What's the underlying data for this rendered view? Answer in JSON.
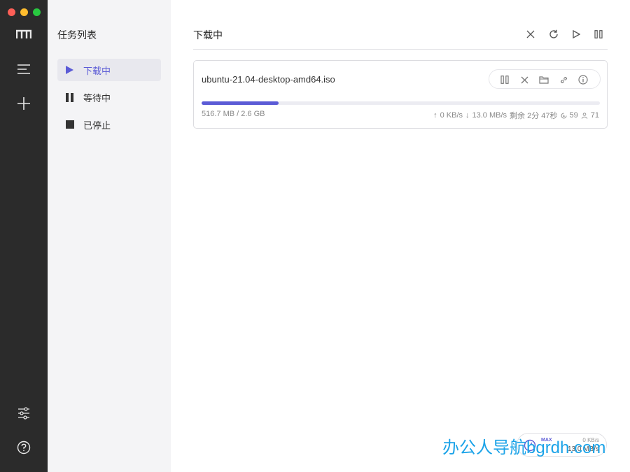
{
  "rail": {
    "colors": {
      "background": "#2b2b2b",
      "icon": "#e8e8e8"
    },
    "icons": [
      "logo-icon",
      "menu-icon",
      "add-icon",
      "settings-icon",
      "help-icon"
    ]
  },
  "task_list": {
    "title": "任务列表",
    "items": [
      {
        "label": "下载中",
        "icon": "play-icon",
        "active": true
      },
      {
        "label": "等待中",
        "icon": "pause-icon",
        "active": false
      },
      {
        "label": "已停止",
        "icon": "stop-icon",
        "active": false
      }
    ]
  },
  "main": {
    "title": "下载中",
    "toolbar_icons": [
      "close-icon",
      "refresh-icon",
      "play-icon",
      "pause-icon"
    ]
  },
  "task": {
    "name": "ubuntu-21.04-desktop-amd64.iso",
    "size": "516.7 MB / 2.6 GB",
    "progress": 0.194,
    "upload_speed": "0 KB/s",
    "download_speed": "13.0 MB/s",
    "remaining": "剩余 2分 47秒",
    "connections": "59",
    "peers": "71",
    "action_icons": [
      "pause-icon",
      "delete-icon",
      "folder-icon",
      "link-icon",
      "info-icon"
    ]
  },
  "speedometer": {
    "mode": "MAX",
    "upload": "0 KB/s",
    "download": "13.0 MB/s"
  },
  "watermark": {
    "text": "办公人导航bgrdh.com"
  },
  "colors": {
    "accent": "#5b5bd6",
    "watermark": "#1ba3e8"
  }
}
